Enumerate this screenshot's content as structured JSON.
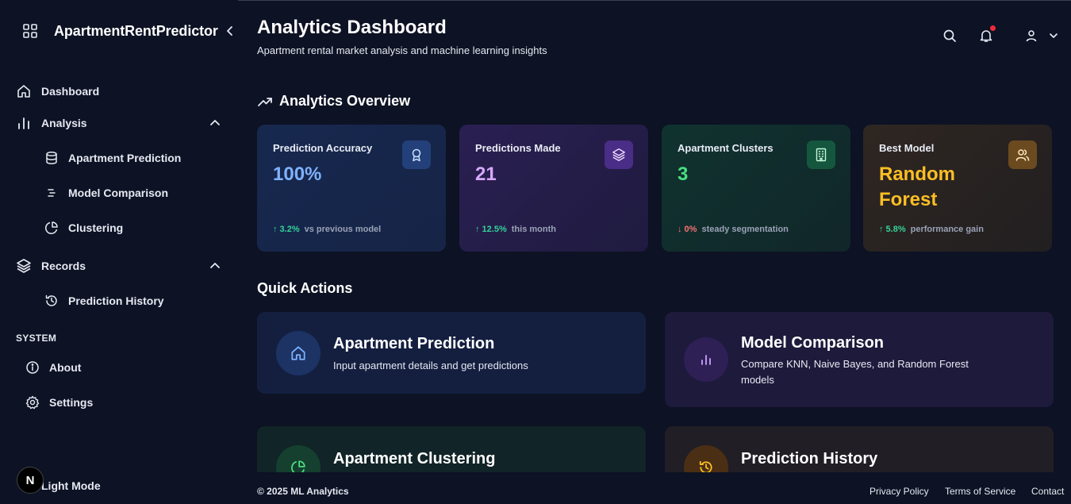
{
  "app": {
    "brand": "ApartmentRentPredictor"
  },
  "sidebar": {
    "dashboard": "Dashboard",
    "analysis": "Analysis",
    "apartment_prediction": "Apartment Prediction",
    "model_comparison": "Model Comparison",
    "clustering": "Clustering",
    "records": "Records",
    "prediction_history": "Prediction History",
    "system_label": "SYSTEM",
    "about": "About",
    "settings": "Settings",
    "light_mode": "Light Mode",
    "badge": "N"
  },
  "header": {
    "title": "Analytics Dashboard",
    "subtitle": "Apartment rental market analysis and machine learning insights"
  },
  "overview": {
    "title": "Analytics Overview",
    "cards": [
      {
        "label": "Prediction Accuracy",
        "value": "100%",
        "trend": "↑ 3.2%",
        "note": "vs previous model",
        "color": "#7fb2ff",
        "trend_color": "#34d399"
      },
      {
        "label": "Predictions Made",
        "value": "21",
        "trend": "↑ 12.5%",
        "note": "this month",
        "color": "#d6a8ff",
        "trend_color": "#34d399"
      },
      {
        "label": "Apartment Clusters",
        "value": "3",
        "trend": "↓ 0%",
        "note": "steady segmentation",
        "color": "#4ade80",
        "trend_color": "#f87171"
      },
      {
        "label": "Best Model",
        "value_line1": "Random",
        "value_line2": "Forest",
        "trend": "↑ 5.8%",
        "note": "performance gain",
        "color": "#fbbf24",
        "trend_color": "#34d399"
      }
    ]
  },
  "quick_actions": {
    "title": "Quick Actions",
    "items": [
      {
        "title": "Apartment Prediction",
        "desc": "Input apartment details and get predictions"
      },
      {
        "title": "Model Comparison",
        "desc": "Compare KNN, Naive Bayes, and Random Forest models"
      },
      {
        "title": "Apartment Clustering"
      },
      {
        "title": "Prediction History"
      }
    ]
  },
  "footer": {
    "copyright": "© 2025 ML Analytics",
    "privacy": "Privacy Policy",
    "terms": "Terms of Service",
    "contact": "Contact"
  }
}
